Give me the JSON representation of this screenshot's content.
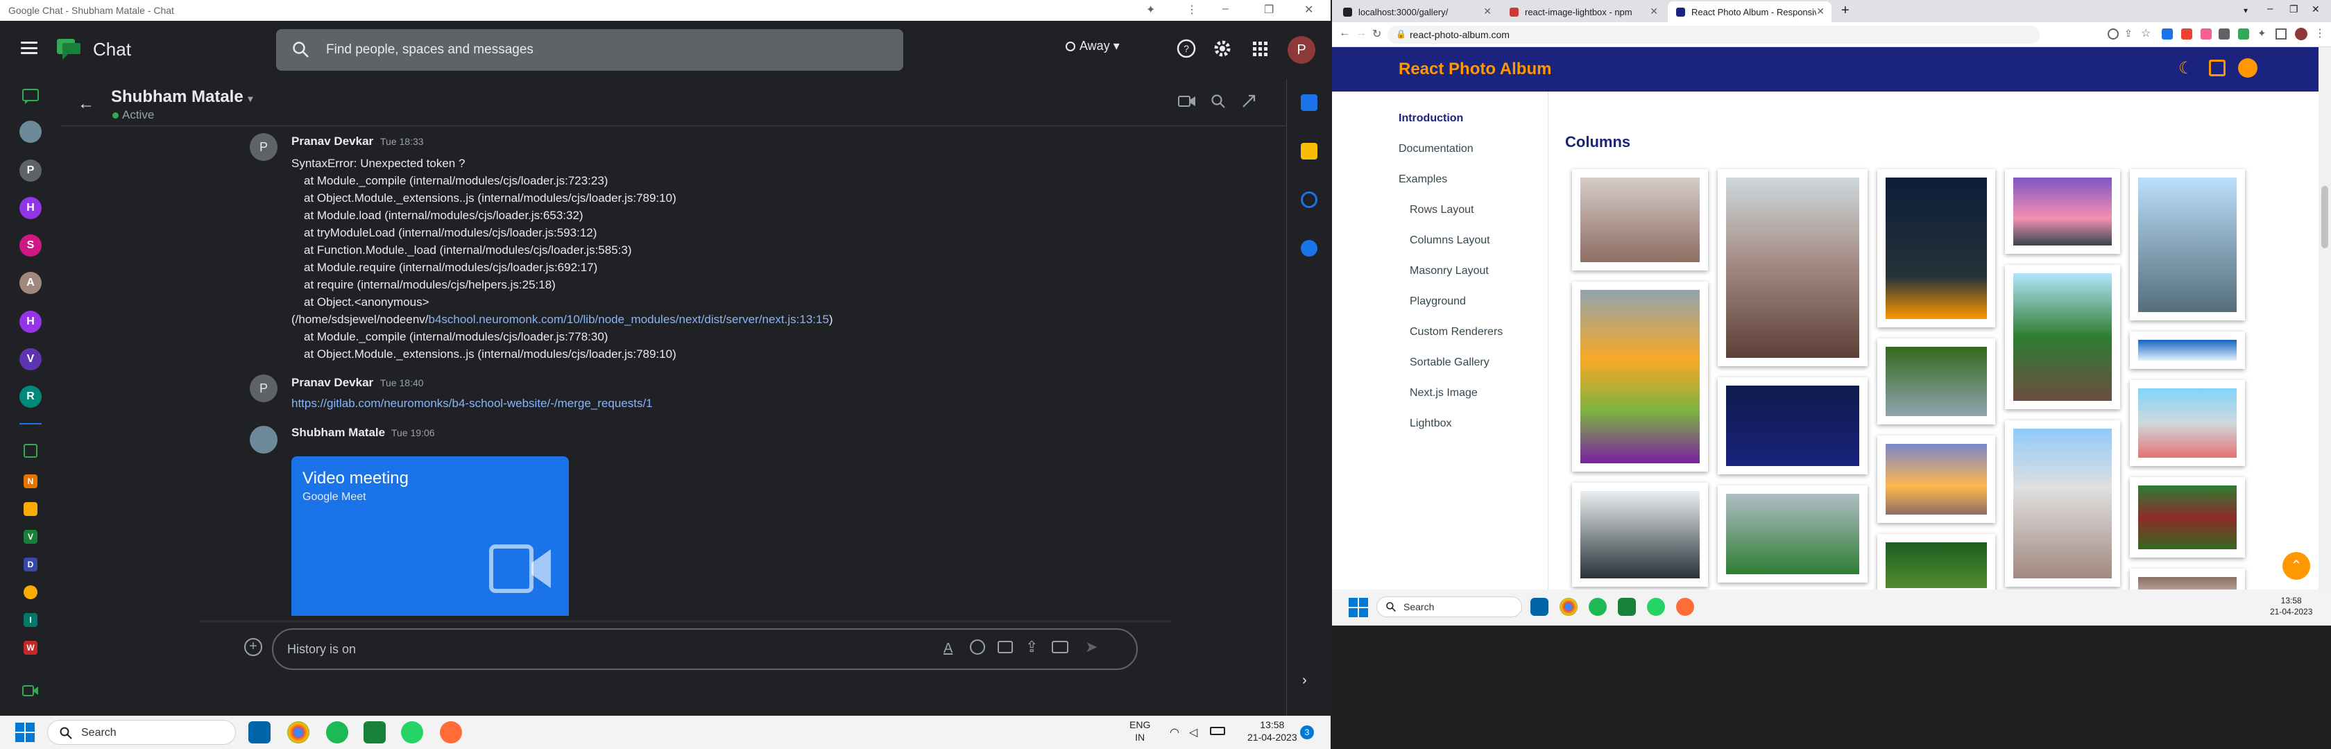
{
  "chat_window": {
    "title": "Google Chat - Shubham Matale - Chat",
    "app_name": "Chat",
    "search_placeholder": "Find people, spaces and messages",
    "status": "Away",
    "user_initial": "P",
    "conversation": {
      "name": "Shubham Matale",
      "status": "Active",
      "messages": [
        {
          "sender": "Pranav Devkar",
          "initial": "P",
          "time": "Tue 18:33",
          "lines": [
            "SyntaxError: Unexpected token ?",
            "at Module._compile (internal/modules/cjs/loader.js:723:23)",
            "at Object.Module._extensions..js (internal/modules/cjs/loader.js:789:10)",
            "at Module.load (internal/modules/cjs/loader.js:653:32)",
            "at tryModuleLoad (internal/modules/cjs/loader.js:593:12)",
            "at Function.Module._load (internal/modules/cjs/loader.js:585:3)",
            "at Module.require (internal/modules/cjs/loader.js:692:17)",
            "at require (internal/modules/cjs/helpers.js:25:18)",
            "at Object.<anonymous>"
          ],
          "path_prefix": "(/home/sdsjewel/nodeenv/",
          "path_link": "b4school.neuromonk.com/10/lib/node_modules/next/dist/server/next.js:13:15",
          "path_suffix": ")",
          "lines_after": [
            "at Module._compile (internal/modules/cjs/loader.js:778:30)",
            "at Object.Module._extensions..js (internal/modules/cjs/loader.js:789:10)"
          ]
        },
        {
          "sender": "Pranav Devkar",
          "initial": "P",
          "time": "Tue 18:40",
          "link": "https://gitlab.com/neuromonks/b4-school-website/-/merge_requests/1"
        },
        {
          "sender": "Shubham Matale",
          "time": "Tue 19:06",
          "card_title": "Video meeting",
          "card_subtitle": "Google Meet"
        }
      ]
    },
    "compose_placeholder": "History is on",
    "rail_avatars": [
      "P",
      "H",
      "S",
      "A",
      "H",
      "V",
      "R"
    ],
    "rail_spaces": [
      "N",
      "V",
      "D",
      "I",
      "W"
    ]
  },
  "left_taskbar": {
    "search_label": "Search",
    "lang": "ENG",
    "region": "IN",
    "time": "13:58",
    "date": "21-04-2023",
    "notif_count": "3"
  },
  "browser": {
    "tabs": [
      {
        "title": "localhost:3000/gallery/"
      },
      {
        "title": "react-image-lightbox - npm"
      },
      {
        "title": "React Photo Album - Responsive"
      }
    ],
    "url": "react-photo-album.com",
    "site_title": "React Photo Album",
    "nav": [
      "Introduction",
      "Documentation",
      "Examples",
      "Rows Layout",
      "Columns Layout",
      "Masonry Layout",
      "Playground",
      "Custom Renderers",
      "Sortable Gallery",
      "Next.js Image",
      "Lightbox"
    ],
    "section_title": "Columns"
  },
  "right_taskbar": {
    "search_label": "Search",
    "time": "13:58",
    "date": "21-04-2023"
  },
  "colors": {
    "chat_bg": "#202124",
    "meet_blue": "#1a73e8",
    "appbar": "#1a237e",
    "brand": "#ff9800",
    "link": "#8ab4f8"
  }
}
